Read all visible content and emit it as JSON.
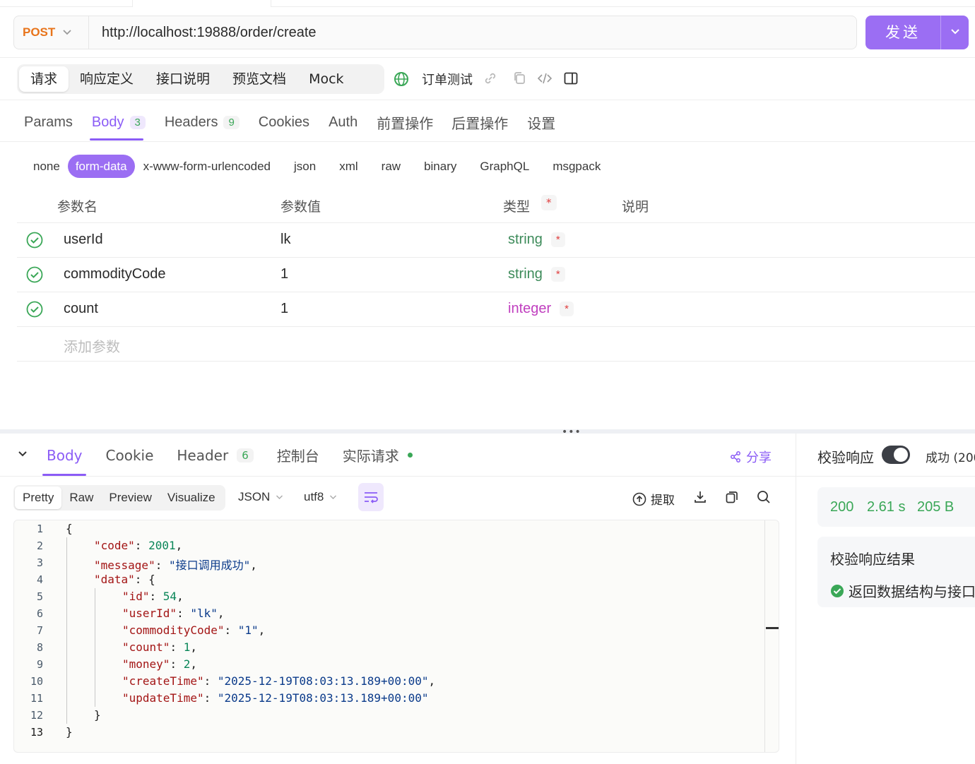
{
  "request": {
    "method": "POST",
    "url": "http://localhost:19888/order/create",
    "send_label": "发送"
  },
  "top_tabs": [
    {
      "label": "请求",
      "active": true
    },
    {
      "label": "响应定义"
    },
    {
      "label": "接口说明"
    },
    {
      "label": "预览文档"
    },
    {
      "label": "Mock"
    }
  ],
  "environment": {
    "name": "订单测试"
  },
  "req_tabs": [
    {
      "label": "Params"
    },
    {
      "label": "Body",
      "badge": "3",
      "active": true
    },
    {
      "label": "Headers",
      "badge": "9"
    },
    {
      "label": "Cookies"
    },
    {
      "label": "Auth"
    },
    {
      "label": "前置操作"
    },
    {
      "label": "后置操作"
    },
    {
      "label": "设置"
    }
  ],
  "body_types": [
    "none",
    "form-data",
    "x-www-form-urlencoded",
    "json",
    "xml",
    "raw",
    "binary",
    "GraphQL",
    "msgpack"
  ],
  "body_type_active": "form-data",
  "params_table": {
    "headers": {
      "name": "参数名",
      "value": "参数值",
      "type": "类型",
      "required_mark": "*",
      "desc": "说明"
    },
    "rows": [
      {
        "name": "userId",
        "value": "lk",
        "type": "string",
        "required": "*"
      },
      {
        "name": "commodityCode",
        "value": "1",
        "type": "string",
        "required": "*"
      },
      {
        "name": "count",
        "value": "1",
        "type": "integer",
        "required": "*"
      }
    ],
    "add_placeholder": "添加参数"
  },
  "splitter_handle": "•••",
  "response": {
    "tabs": [
      {
        "label": "Body",
        "active": true
      },
      {
        "label": "Cookie"
      },
      {
        "label": "Header",
        "badge": "6"
      },
      {
        "label": "控制台"
      },
      {
        "label": "实际请求"
      }
    ],
    "share_label": "分享",
    "view_modes": [
      "Pretty",
      "Raw",
      "Preview",
      "Visualize"
    ],
    "format": "JSON",
    "encoding": "utf8",
    "extract_label": "提取",
    "code_lines": [
      {
        "n": "1"
      },
      {
        "n": "2",
        "key": "\"code\"",
        "num": "2001"
      },
      {
        "n": "3",
        "key": "\"message\"",
        "str": "\"接口调用成功\""
      },
      {
        "n": "4",
        "key": "\"data\""
      },
      {
        "n": "5",
        "key": "\"id\"",
        "num": "54"
      },
      {
        "n": "6",
        "key": "\"userId\"",
        "str": "\"lk\""
      },
      {
        "n": "7",
        "key": "\"commodityCode\"",
        "str": "\"1\""
      },
      {
        "n": "8",
        "key": "\"count\"",
        "num": "1"
      },
      {
        "n": "9",
        "key": "\"money\"",
        "num": "2"
      },
      {
        "n": "10",
        "key": "\"createTime\"",
        "str": "\"2025-12-19T08:03:13.189+00:00\""
      },
      {
        "n": "11",
        "key": "\"updateTime\"",
        "str": "\"2025-12-19T08:03:13.189+00:00\""
      },
      {
        "n": "12"
      },
      {
        "n": "13"
      }
    ]
  },
  "verify": {
    "label": "校验响应",
    "enabled": true,
    "status_text": "成功 (200",
    "status_code": "200",
    "time": "2.61 s",
    "size": "205 B",
    "result_title": "校验响应结果",
    "result_line": "返回数据结构与接口"
  },
  "colors": {
    "accent": "#9b6ef3",
    "method": "#e8741b",
    "success": "#3aa757",
    "integer": "#c03fbf",
    "string": "#3d8b5a"
  }
}
